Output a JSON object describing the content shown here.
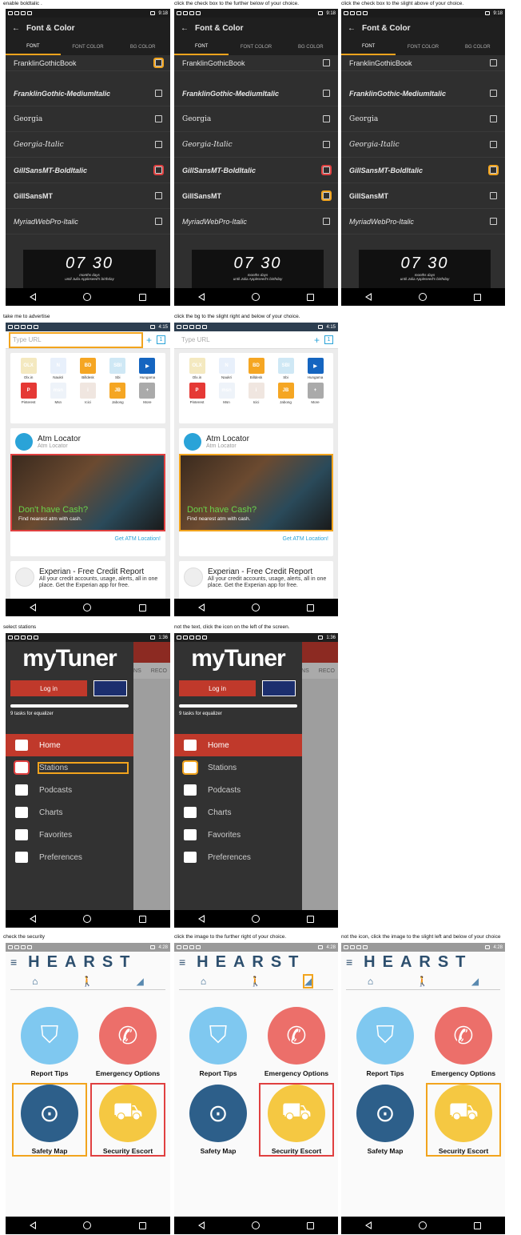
{
  "captions": [
    "enable boldtalic .",
    "click the check box to the further below of your choice.",
    "click the check box to the slight above of your choice.",
    "take me to advertise",
    "click the bg to the slight right and below of your choice.",
    "select stations",
    "not the text, click the icon on the left of the screen.",
    "check the security",
    "click the image to the further right of your choice.",
    "not the icon, click the image to the slight left and below of your choice"
  ],
  "font": {
    "time": "9:18",
    "title": "Font & Color",
    "tabs": [
      "FONT",
      "FONT COLOR",
      "BG COLOR"
    ],
    "fonts": [
      "FranklinGothicBook",
      "FranklinGothic-MediumItalic",
      "Georgia",
      "Georgia-Italic",
      "GillSansMT-BoldItalic",
      "GillSansMT",
      "MyriadWebPro-Italic"
    ],
    "clock": "07 30",
    "clock_sub": "months      days",
    "clock_caption": "until Julia Appleseed's birthday",
    "back_icon": "arrow-left-icon"
  },
  "browser": {
    "time": "4:15",
    "url_placeholder": "Type URL",
    "plus": "+",
    "count": "1",
    "apps": [
      {
        "name": "Olx.in",
        "color": "#f4e9c0",
        "text": "OLX"
      },
      {
        "name": "Naukri",
        "color": "#e8f0fb",
        "text": "N"
      },
      {
        "name": "Billdesk",
        "color": "#f5a623",
        "text": "BD"
      },
      {
        "name": "Sbi",
        "color": "#cfe8f5",
        "text": "SBI"
      },
      {
        "name": "Hungama",
        "color": "#1565c0",
        "text": "▶"
      },
      {
        "name": "Pinterest",
        "color": "#e53935",
        "text": "P"
      },
      {
        "name": "Msn",
        "color": "#eef3f9",
        "text": "msn"
      },
      {
        "name": "Icici",
        "color": "#f0e6e0",
        "text": "i"
      },
      {
        "name": "Jabong",
        "color": "#f5a623",
        "text": "JB"
      },
      {
        "name": "More",
        "color": "#aaaaaa",
        "text": "+"
      }
    ],
    "atm_title": "Atm Locator",
    "atm_sub": "Atm Locator",
    "banner_title": "Don't have Cash?",
    "banner_sub": "Find nearest atm with cash.",
    "cta": "Get ATM Location!",
    "exp_title": "Experian - Free Credit Report",
    "exp_sub": "All your credit accounts, usage, alerts, all in one place. Get the Experian app for free."
  },
  "tuner": {
    "time": "1:36",
    "logo": "myTuner",
    "login": "Log in",
    "tasks": "9 tasks for equalizer",
    "menu": [
      "Home",
      "Stations",
      "Podcasts",
      "Charts",
      "Favorites",
      "Preferences"
    ],
    "bg_tabs": [
      "TIONS",
      "RECO"
    ],
    "bg_text": "vel."
  },
  "hearst": {
    "time": "4:28",
    "brand": "HEARST",
    "menu_icon": "≡",
    "items": [
      {
        "label": "Report Tips",
        "color": "#7fc8f0",
        "glyph": "⛉"
      },
      {
        "label": "Emergency Options",
        "color": "#ec6f6a",
        "glyph": "✆"
      },
      {
        "label": "Safety Map",
        "color": "#2d5f8a",
        "glyph": "⊙"
      },
      {
        "label": "Security Escort",
        "color": "#f5c842",
        "glyph": "⛟"
      }
    ]
  }
}
